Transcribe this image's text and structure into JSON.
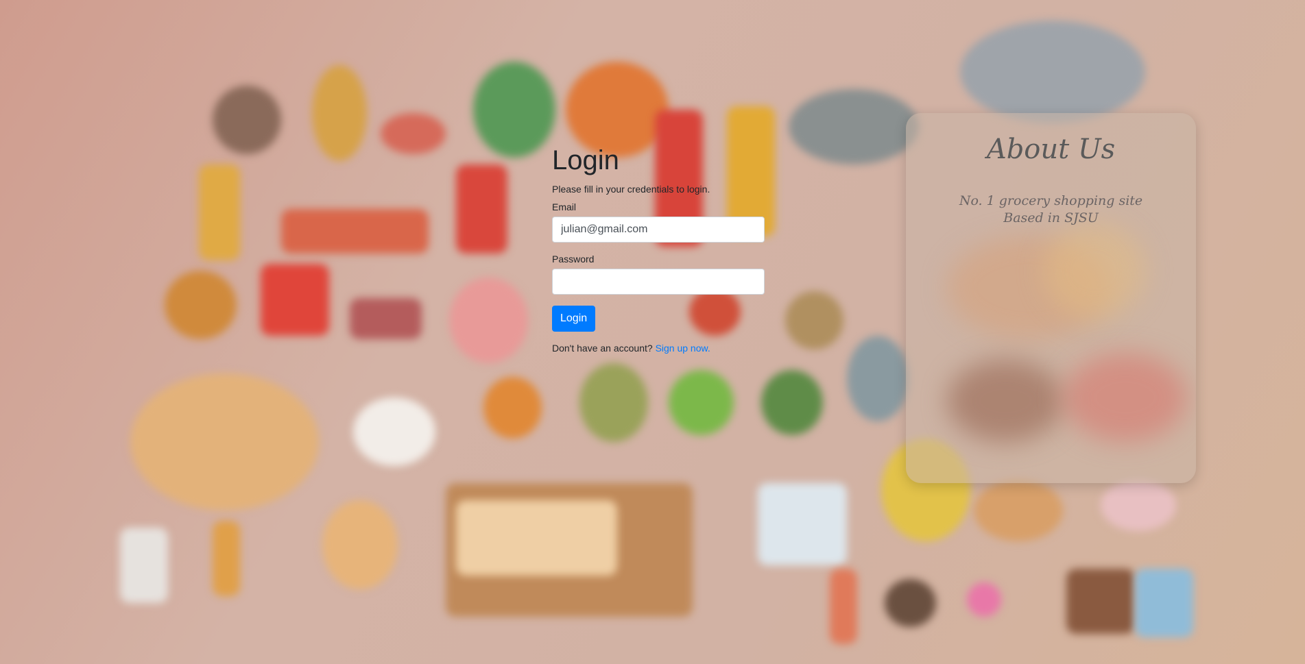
{
  "login": {
    "title": "Login",
    "subtitle": "Please fill in your credentials to login.",
    "email_label": "Email",
    "email_value": "julian@gmail.com",
    "password_label": "Password",
    "password_value": "",
    "button_label": "Login",
    "signup_prompt": "Don't have an account?",
    "signup_link": "Sign up now."
  },
  "about": {
    "title": "About Us",
    "line1": "No. 1 grocery shopping site",
    "line2": "Based in SJSU"
  },
  "colors": {
    "primary": "#007bff",
    "text": "#212529"
  }
}
